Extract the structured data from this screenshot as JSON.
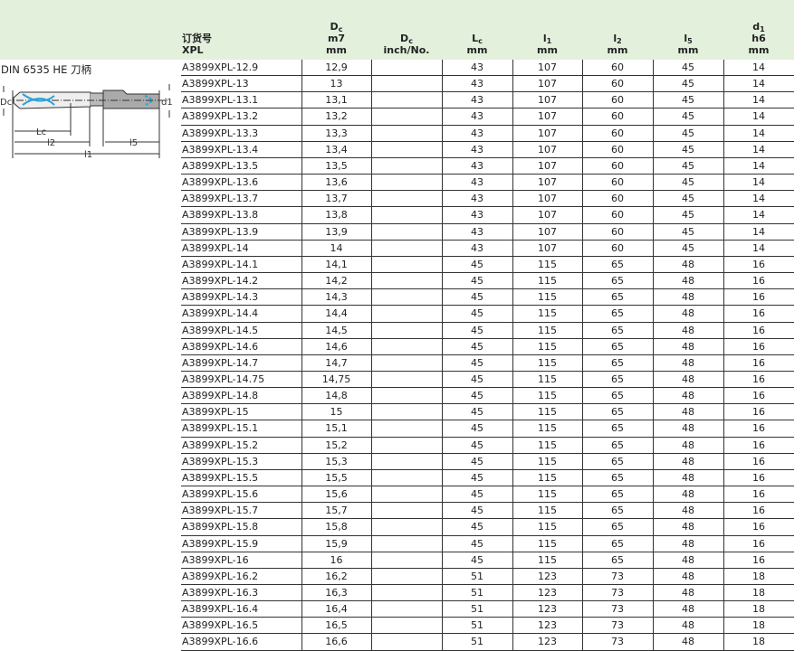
{
  "header": {
    "order": [
      "订货号",
      "XPL"
    ],
    "dc": [
      "D",
      "c",
      "m7",
      "mm"
    ],
    "dc_inch": [
      "D",
      "c",
      "inch/No."
    ],
    "lc": [
      "L",
      "c",
      "mm"
    ],
    "l1": [
      "l",
      "1",
      "mm"
    ],
    "l2": [
      "l",
      "2",
      "mm"
    ],
    "l5": [
      "l",
      "5",
      "mm"
    ],
    "d1": [
      "d",
      "1",
      "h6",
      "mm"
    ]
  },
  "section_title": "DIN 6535 HE 刀柄",
  "drawing_labels": {
    "dc": "Dc",
    "d1": "d1",
    "lc": "Lc",
    "l2": "l2",
    "l5": "l5",
    "l1": "l1"
  },
  "rows": [
    [
      "A3899XPL-12.9",
      "12,9",
      "",
      "43",
      "107",
      "60",
      "45",
      "14"
    ],
    [
      "A3899XPL-13",
      "13",
      "",
      "43",
      "107",
      "60",
      "45",
      "14"
    ],
    [
      "A3899XPL-13.1",
      "13,1",
      "",
      "43",
      "107",
      "60",
      "45",
      "14"
    ],
    [
      "A3899XPL-13.2",
      "13,2",
      "",
      "43",
      "107",
      "60",
      "45",
      "14"
    ],
    [
      "A3899XPL-13.3",
      "13,3",
      "",
      "43",
      "107",
      "60",
      "45",
      "14"
    ],
    [
      "A3899XPL-13.4",
      "13,4",
      "",
      "43",
      "107",
      "60",
      "45",
      "14"
    ],
    [
      "A3899XPL-13.5",
      "13,5",
      "",
      "43",
      "107",
      "60",
      "45",
      "14"
    ],
    [
      "A3899XPL-13.6",
      "13,6",
      "",
      "43",
      "107",
      "60",
      "45",
      "14"
    ],
    [
      "A3899XPL-13.7",
      "13,7",
      "",
      "43",
      "107",
      "60",
      "45",
      "14"
    ],
    [
      "A3899XPL-13.8",
      "13,8",
      "",
      "43",
      "107",
      "60",
      "45",
      "14"
    ],
    [
      "A3899XPL-13.9",
      "13,9",
      "",
      "43",
      "107",
      "60",
      "45",
      "14"
    ],
    [
      "A3899XPL-14",
      "14",
      "",
      "43",
      "107",
      "60",
      "45",
      "14"
    ],
    [
      "A3899XPL-14.1",
      "14,1",
      "",
      "45",
      "115",
      "65",
      "48",
      "16"
    ],
    [
      "A3899XPL-14.2",
      "14,2",
      "",
      "45",
      "115",
      "65",
      "48",
      "16"
    ],
    [
      "A3899XPL-14.3",
      "14,3",
      "",
      "45",
      "115",
      "65",
      "48",
      "16"
    ],
    [
      "A3899XPL-14.4",
      "14,4",
      "",
      "45",
      "115",
      "65",
      "48",
      "16"
    ],
    [
      "A3899XPL-14.5",
      "14,5",
      "",
      "45",
      "115",
      "65",
      "48",
      "16"
    ],
    [
      "A3899XPL-14.6",
      "14,6",
      "",
      "45",
      "115",
      "65",
      "48",
      "16"
    ],
    [
      "A3899XPL-14.7",
      "14,7",
      "",
      "45",
      "115",
      "65",
      "48",
      "16"
    ],
    [
      "A3899XPL-14.75",
      "14,75",
      "",
      "45",
      "115",
      "65",
      "48",
      "16"
    ],
    [
      "A3899XPL-14.8",
      "14,8",
      "",
      "45",
      "115",
      "65",
      "48",
      "16"
    ],
    [
      "A3899XPL-15",
      "15",
      "",
      "45",
      "115",
      "65",
      "48",
      "16"
    ],
    [
      "A3899XPL-15.1",
      "15,1",
      "",
      "45",
      "115",
      "65",
      "48",
      "16"
    ],
    [
      "A3899XPL-15.2",
      "15,2",
      "",
      "45",
      "115",
      "65",
      "48",
      "16"
    ],
    [
      "A3899XPL-15.3",
      "15,3",
      "",
      "45",
      "115",
      "65",
      "48",
      "16"
    ],
    [
      "A3899XPL-15.5",
      "15,5",
      "",
      "45",
      "115",
      "65",
      "48",
      "16"
    ],
    [
      "A3899XPL-15.6",
      "15,6",
      "",
      "45",
      "115",
      "65",
      "48",
      "16"
    ],
    [
      "A3899XPL-15.7",
      "15,7",
      "",
      "45",
      "115",
      "65",
      "48",
      "16"
    ],
    [
      "A3899XPL-15.8",
      "15,8",
      "",
      "45",
      "115",
      "65",
      "48",
      "16"
    ],
    [
      "A3899XPL-15.9",
      "15,9",
      "",
      "45",
      "115",
      "65",
      "48",
      "16"
    ],
    [
      "A3899XPL-16",
      "16",
      "",
      "45",
      "115",
      "65",
      "48",
      "16"
    ],
    [
      "A3899XPL-16.2",
      "16,2",
      "",
      "51",
      "123",
      "73",
      "48",
      "18"
    ],
    [
      "A3899XPL-16.3",
      "16,3",
      "",
      "51",
      "123",
      "73",
      "48",
      "18"
    ],
    [
      "A3899XPL-16.4",
      "16,4",
      "",
      "51",
      "123",
      "73",
      "48",
      "18"
    ],
    [
      "A3899XPL-16.5",
      "16,5",
      "",
      "51",
      "123",
      "73",
      "48",
      "18"
    ],
    [
      "A3899XPL-16.6",
      "16,6",
      "",
      "51",
      "123",
      "73",
      "48",
      "18"
    ]
  ]
}
